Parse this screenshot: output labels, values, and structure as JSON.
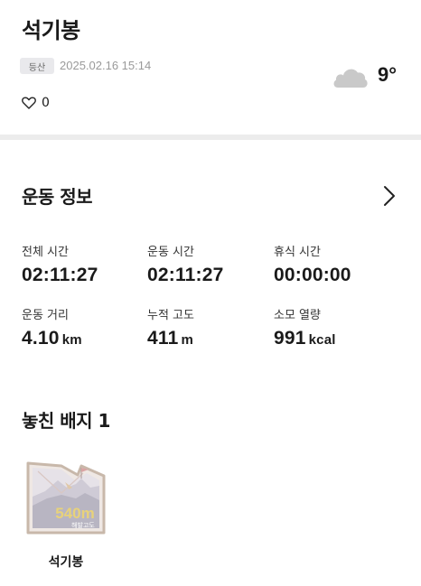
{
  "header": {
    "title": "석기봉",
    "tag": "등산",
    "datetime": "2025.02.16 15:14",
    "like_count": "0",
    "weather_icon": "cloud-icon",
    "temperature": "9°"
  },
  "exercise_info": {
    "title": "운동 정보",
    "stats": [
      {
        "label": "전체 시간",
        "value": "02:11:27",
        "unit": ""
      },
      {
        "label": "운동 시간",
        "value": "02:11:27",
        "unit": ""
      },
      {
        "label": "휴식 시간",
        "value": "00:00:00",
        "unit": ""
      },
      {
        "label": "운동 거리",
        "value": "4.10",
        "unit": "km"
      },
      {
        "label": "누적 고도",
        "value": "411",
        "unit": "m"
      },
      {
        "label": "소모 열량",
        "value": "991",
        "unit": "kcal"
      }
    ]
  },
  "badges": {
    "title": "놓친 배지 1",
    "items": [
      {
        "name": "석기봉",
        "altitude": "540m",
        "altitude_label": "해발고도"
      }
    ]
  },
  "colors": {
    "badge_frame": "#c8b8aa",
    "badge_altitude": "#e8d27a",
    "divider": "#ececec"
  }
}
